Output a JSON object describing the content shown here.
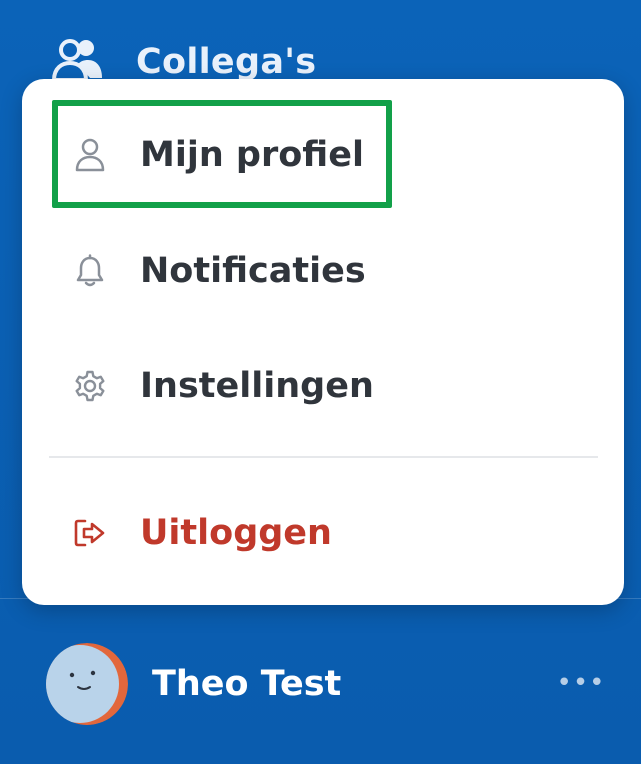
{
  "nav": {
    "colleagues_label": "Collega's",
    "colleagues_icon": "users-icon"
  },
  "menu": {
    "items": [
      {
        "label": "Mijn profiel",
        "icon": "user-icon"
      },
      {
        "label": "Notificaties",
        "icon": "bell-icon"
      },
      {
        "label": "Instellingen",
        "icon": "gear-icon"
      },
      {
        "label": "Uitloggen",
        "icon": "logout-icon"
      }
    ],
    "highlighted": "Mijn profiel"
  },
  "user": {
    "name": "Theo Test",
    "more_label": "•••"
  },
  "colors": {
    "sidebar_bg": "#0a5fb4",
    "logout": "#c0392b",
    "highlight": "#12a049"
  }
}
